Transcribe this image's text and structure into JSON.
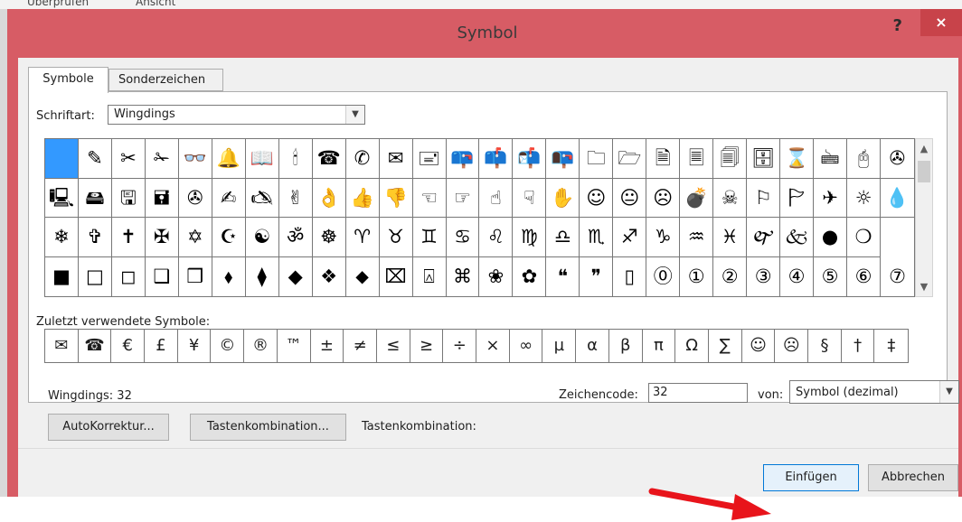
{
  "background": {
    "ribbon_tabs": [
      "Überprüfen",
      "Ansicht"
    ]
  },
  "window": {
    "title": "Symbol",
    "help": "?",
    "close": "×"
  },
  "tabs": [
    "Symbole",
    "Sonderzeichen"
  ],
  "font": {
    "label": "Schriftart:",
    "value": "Wingdings"
  },
  "symbol_grid": {
    "rows": [
      [
        " ",
        "✎",
        "✂",
        "✁",
        "👓",
        "🔔",
        "📖",
        "🕯",
        "☎",
        "✆",
        "✉",
        "🖃",
        "📪",
        "📫",
        "📬",
        "📭",
        "🗀",
        "🗁",
        "🗎",
        "🗏",
        "🗐",
        "🗄",
        "⌛",
        "🖮",
        "🖰",
        "✇"
      ],
      [
        "🖳",
        "🖴",
        "🖫",
        "🖬",
        "✇",
        "✍",
        "🖎",
        "✌",
        "👌",
        "👍",
        "👎",
        "☜",
        "☞",
        "☝",
        "☟",
        "✋",
        "☺",
        "😐",
        "☹",
        "💣",
        "☠",
        "⚐",
        "🏱",
        "✈",
        "☼",
        "💧"
      ],
      [
        "❄",
        "✞",
        "✝",
        "✠",
        "✡",
        "☪",
        "☯",
        "ॐ",
        "☸",
        "♈",
        "♉",
        "♊",
        "♋",
        "♌",
        "♍",
        "♎",
        "♏",
        "♐",
        "♑",
        "♒",
        "♓",
        "🙰",
        "🙵",
        "●",
        "❍"
      ],
      [
        "■",
        "□",
        "◻",
        "❑",
        "❒",
        "⬧",
        "⧫",
        "◆",
        "❖",
        "⬥",
        "⌧",
        "⍓",
        "⌘",
        "❀",
        "✿",
        "❝",
        "❞",
        "▯",
        "⓪",
        "①",
        "②",
        "③",
        "④",
        "⑤",
        "⑥",
        "⑦"
      ]
    ],
    "selected_index": 0
  },
  "recent": {
    "label": "Zuletzt verwendete Symbole:",
    "items": [
      "✉",
      "☎",
      "€",
      "£",
      "¥",
      "©",
      "®",
      "™",
      "±",
      "≠",
      "≤",
      "≥",
      "÷",
      "×",
      "∞",
      "µ",
      "α",
      "β",
      "π",
      "Ω",
      "∑",
      "☺",
      "☹",
      "§",
      "†",
      "‡"
    ]
  },
  "info": {
    "text": "Wingdings: 32"
  },
  "code": {
    "label": "Zeichencode:",
    "value": "32"
  },
  "from": {
    "label": "von:",
    "value": "Symbol (dezimal)"
  },
  "buttons": {
    "autocorrect": "AutoKorrektur...",
    "shortcut": "Tastenkombination...",
    "shortcut_label": "Tastenkombination:",
    "insert": "Einfügen",
    "cancel": "Abbrechen"
  },
  "colors": {
    "window_frame": "#d75c65",
    "selected_cell": "#3399ff",
    "annotation_arrow": "#e8141b"
  },
  "annotation": {
    "arrow": "red arrow pointing at insert button"
  }
}
